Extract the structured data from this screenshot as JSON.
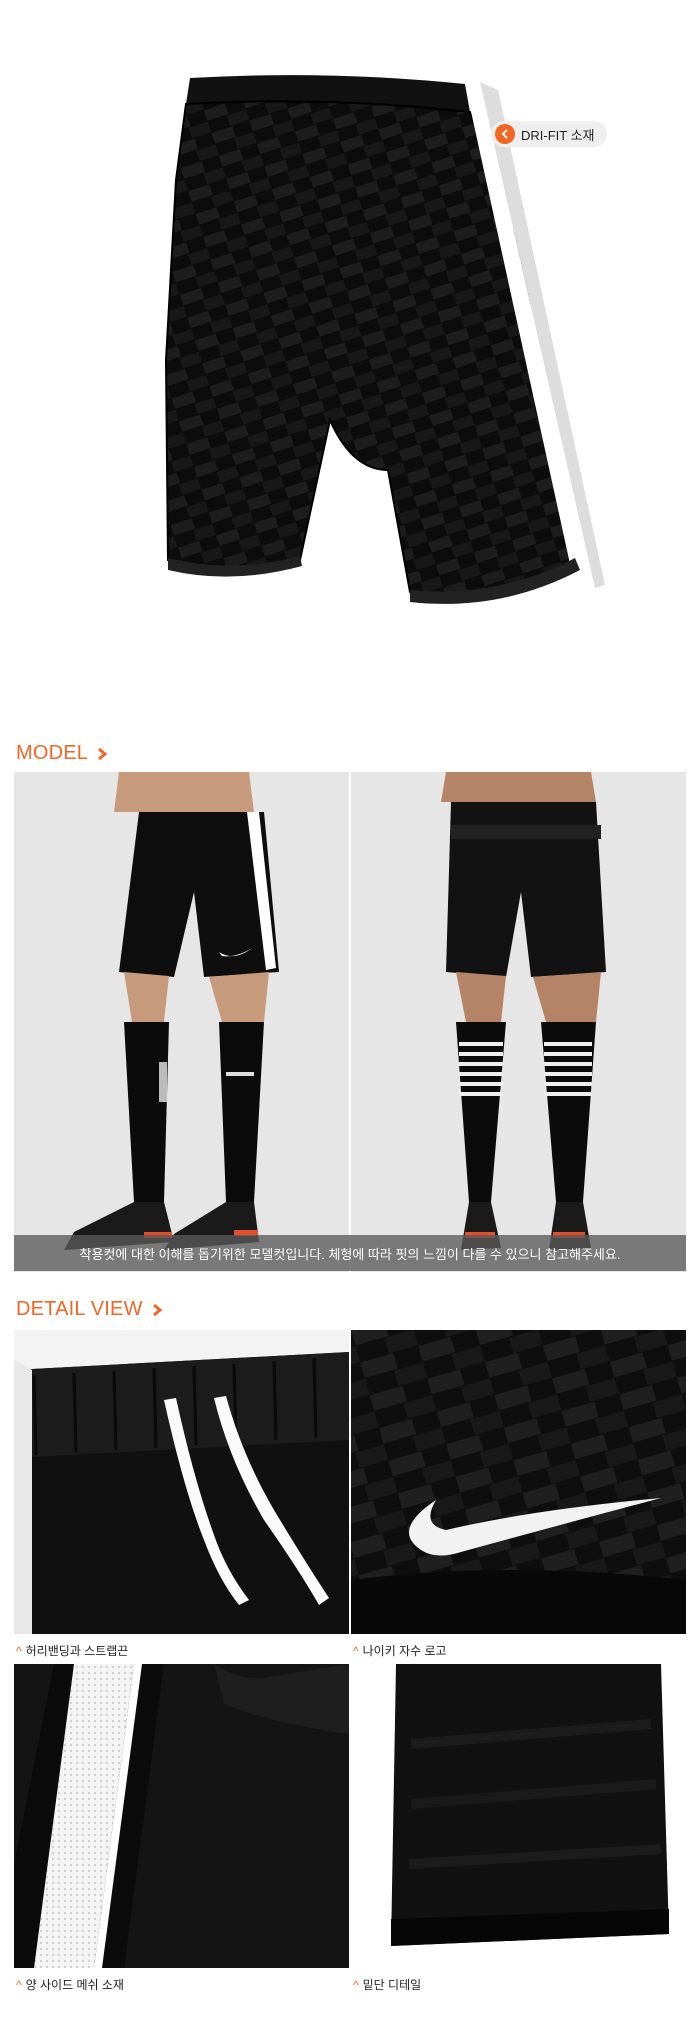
{
  "hero": {
    "feature_tag": "DRI-FIT 소재",
    "colors": {
      "accent": "#f26522",
      "tag_bg": "#eeeeee"
    }
  },
  "model": {
    "title": "MODEL",
    "caption": "착용컷에 대한 이해를 돕기위한 모델컷입니다. 체형에 따라 핏의 느낌이 다를 수 있으니 참고해주세요."
  },
  "detail": {
    "title": "DETAIL VIEW",
    "items": [
      {
        "caption": "허리밴딩과 스트랩끈"
      },
      {
        "caption": "나이키 자수 로고"
      },
      {
        "caption": "양 사이드 메쉬 소재"
      },
      {
        "caption": "밑단 디테일"
      }
    ]
  }
}
